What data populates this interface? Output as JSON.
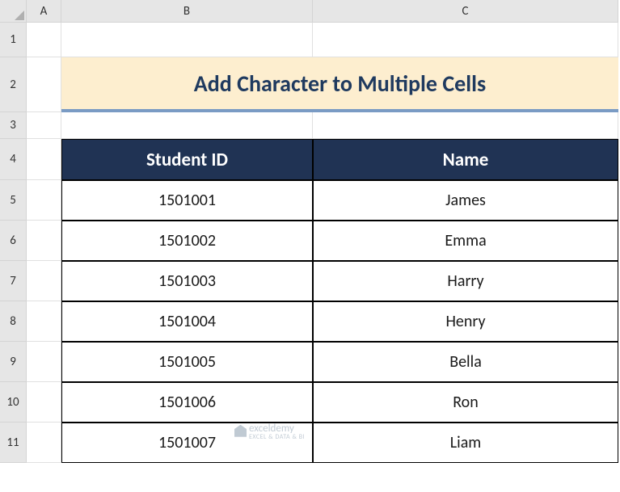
{
  "columns": [
    "A",
    "B",
    "C"
  ],
  "rows": [
    "1",
    "2",
    "3",
    "4",
    "5",
    "6",
    "7",
    "8",
    "9",
    "10",
    "11"
  ],
  "title": "Add Character to Multiple Cells",
  "table": {
    "headers": [
      "Student ID",
      "Name"
    ],
    "data": [
      {
        "id": "1501001",
        "name": "James"
      },
      {
        "id": "1501002",
        "name": "Emma"
      },
      {
        "id": "1501003",
        "name": "Harry"
      },
      {
        "id": "1501004",
        "name": "Henry"
      },
      {
        "id": "1501005",
        "name": "Bella"
      },
      {
        "id": "1501006",
        "name": "Ron"
      },
      {
        "id": "1501007",
        "name": "Liam"
      }
    ]
  },
  "watermark": {
    "name": "exceldemy",
    "tagline": "EXCEL & DATA & BI"
  },
  "chart_data": {
    "type": "table",
    "title": "Add Character to Multiple Cells",
    "headers": [
      "Student ID",
      "Name"
    ],
    "rows": [
      [
        "1501001",
        "James"
      ],
      [
        "1501002",
        "Emma"
      ],
      [
        "1501003",
        "Harry"
      ],
      [
        "1501004",
        "Henry"
      ],
      [
        "1501005",
        "Bella"
      ],
      [
        "1501006",
        "Ron"
      ],
      [
        "1501007",
        "Liam"
      ]
    ]
  }
}
